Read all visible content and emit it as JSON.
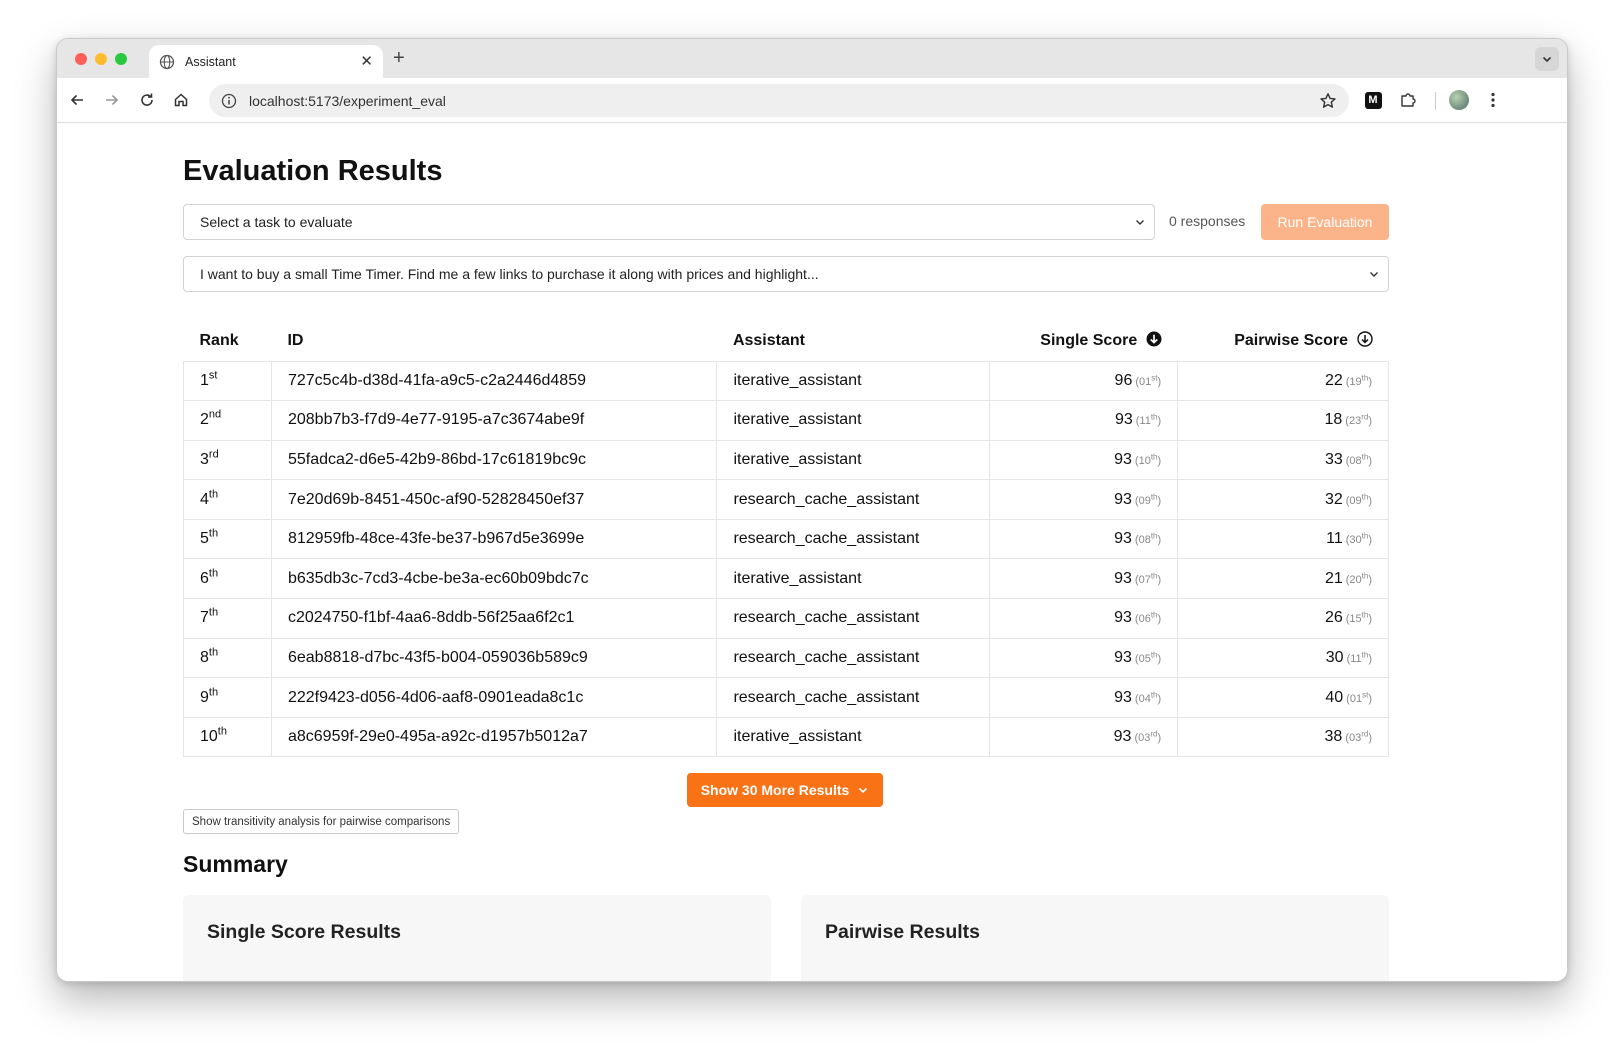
{
  "browser": {
    "tab_title": "Assistant",
    "url": "localhost:5173/experiment_eval"
  },
  "page": {
    "title": "Evaluation Results",
    "task_select_value": "Select a task to evaluate",
    "responses_count": "0 responses",
    "run_button": "Run Evaluation",
    "query_select_value": "I want to buy a small Time Timer. Find me a few links to purchase it along with prices and highlight...",
    "table": {
      "headers": {
        "rank": "Rank",
        "id": "ID",
        "assistant": "Assistant",
        "single": "Single Score",
        "pairwise": "Pairwise Score"
      },
      "rows": [
        {
          "rank": "1",
          "rank_ord": "st",
          "id": "727c5c4b-d38d-41fa-a9c5-c2a2446d4859",
          "assistant": "iterative_assistant",
          "single": "96",
          "single_rank": "01",
          "single_ord": "st",
          "pair": "22",
          "pair_rank": "19",
          "pair_ord": "th"
        },
        {
          "rank": "2",
          "rank_ord": "nd",
          "id": "208bb7b3-f7d9-4e77-9195-a7c3674abe9f",
          "assistant": "iterative_assistant",
          "single": "93",
          "single_rank": "11",
          "single_ord": "th",
          "pair": "18",
          "pair_rank": "23",
          "pair_ord": "rd"
        },
        {
          "rank": "3",
          "rank_ord": "rd",
          "id": "55fadca2-d6e5-42b9-86bd-17c61819bc9c",
          "assistant": "iterative_assistant",
          "single": "93",
          "single_rank": "10",
          "single_ord": "th",
          "pair": "33",
          "pair_rank": "08",
          "pair_ord": "th"
        },
        {
          "rank": "4",
          "rank_ord": "th",
          "id": "7e20d69b-8451-450c-af90-52828450ef37",
          "assistant": "research_cache_assistant",
          "single": "93",
          "single_rank": "09",
          "single_ord": "th",
          "pair": "32",
          "pair_rank": "09",
          "pair_ord": "th"
        },
        {
          "rank": "5",
          "rank_ord": "th",
          "id": "812959fb-48ce-43fe-be37-b967d5e3699e",
          "assistant": "research_cache_assistant",
          "single": "93",
          "single_rank": "08",
          "single_ord": "th",
          "pair": "11",
          "pair_rank": "30",
          "pair_ord": "th"
        },
        {
          "rank": "6",
          "rank_ord": "th",
          "id": "b635db3c-7cd3-4cbe-be3a-ec60b09bdc7c",
          "assistant": "iterative_assistant",
          "single": "93",
          "single_rank": "07",
          "single_ord": "th",
          "pair": "21",
          "pair_rank": "20",
          "pair_ord": "th"
        },
        {
          "rank": "7",
          "rank_ord": "th",
          "id": "c2024750-f1bf-4aa6-8ddb-56f25aa6f2c1",
          "assistant": "research_cache_assistant",
          "single": "93",
          "single_rank": "06",
          "single_ord": "th",
          "pair": "26",
          "pair_rank": "15",
          "pair_ord": "th"
        },
        {
          "rank": "8",
          "rank_ord": "th",
          "id": "6eab8818-d7bc-43f5-b004-059036b589c9",
          "assistant": "research_cache_assistant",
          "single": "93",
          "single_rank": "05",
          "single_ord": "th",
          "pair": "30",
          "pair_rank": "11",
          "pair_ord": "th"
        },
        {
          "rank": "9",
          "rank_ord": "th",
          "id": "222f9423-d056-4d06-aaf8-0901eada8c1c",
          "assistant": "research_cache_assistant",
          "single": "93",
          "single_rank": "04",
          "single_ord": "th",
          "pair": "40",
          "pair_rank": "01",
          "pair_ord": "st"
        },
        {
          "rank": "10",
          "rank_ord": "th",
          "id": "a8c6959f-29e0-495a-a92c-d1957b5012a7",
          "assistant": "iterative_assistant",
          "single": "93",
          "single_rank": "03",
          "single_ord": "rd",
          "pair": "38",
          "pair_rank": "03",
          "pair_ord": "rd"
        }
      ]
    },
    "more_button": "Show 30 More Results",
    "transitivity_button": "Show transitivity analysis for pairwise comparisons",
    "summary_title": "Summary",
    "single_card_title": "Single Score Results",
    "pairwise_card_title": "Pairwise Results"
  },
  "colors": {
    "accent": "#f97316",
    "accent_disabled": "#fbb48a"
  },
  "icons": [
    "globe-icon",
    "close-icon",
    "plus-icon",
    "back-icon",
    "forward-icon",
    "reload-icon",
    "home-icon",
    "info-icon",
    "star-icon",
    "puzzle-icon",
    "kebab-icon",
    "chevron-down-icon",
    "sort-down-icon"
  ]
}
